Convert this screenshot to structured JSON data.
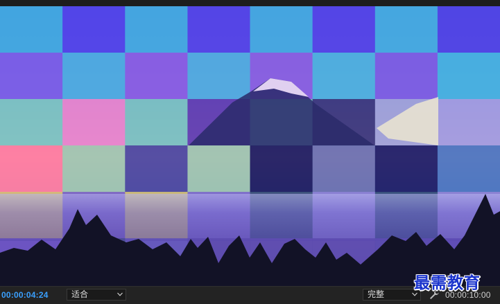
{
  "viewer": {
    "current_timecode": "00:00:04:24",
    "duration_timecode": "00:00:10:00",
    "zoom_select": {
      "selected": "适合"
    },
    "quality_select": {
      "selected": "完整"
    },
    "settings_icon": "wrench-icon"
  },
  "frame": {
    "description_icon": "video-frame",
    "grid": {
      "columns": 8,
      "rows": 6
    },
    "tile_colors": [
      [
        "#41aee0",
        "#5345e8",
        "#43aee0",
        "#5545e6",
        "#44aee0",
        "#5545e6",
        "#44b0e0",
        "#5045e4"
      ],
      [
        "#7b5fe6",
        "#4cb0df",
        "#8a5fe2",
        "#50b0de",
        "#8a62e0",
        "#4db5dd",
        "#7d60e2",
        "#44b6df"
      ],
      [
        "#7bc8c0",
        "#e888cc",
        "#78c5c0",
        "#6040b0",
        "#74c3c1",
        "#3a3a7a",
        "#a0a6d8",
        "#a2a0e0"
      ],
      [
        "#ff7f9f",
        "#a0cab0",
        "#4a4aa0",
        "#9dc9b0",
        "#1b1e60",
        "#6a74b0",
        "#1b1f66",
        "#4a78c0"
      ],
      [
        "#e6cf60",
        "#7a66c0",
        "#ddd060",
        "#7a6cc8",
        "#2b4f68",
        "#8a86d4",
        "#244e6a",
        "#8c88d6"
      ],
      [
        "#6a52c0",
        "#2a4a5a",
        "#6258b8",
        "#5848a8",
        "#5a4aa8",
        "#5a4aa8",
        "#5448a8",
        "#5a4ab0"
      ]
    ]
  },
  "watermark": {
    "text": "最需教育"
  }
}
